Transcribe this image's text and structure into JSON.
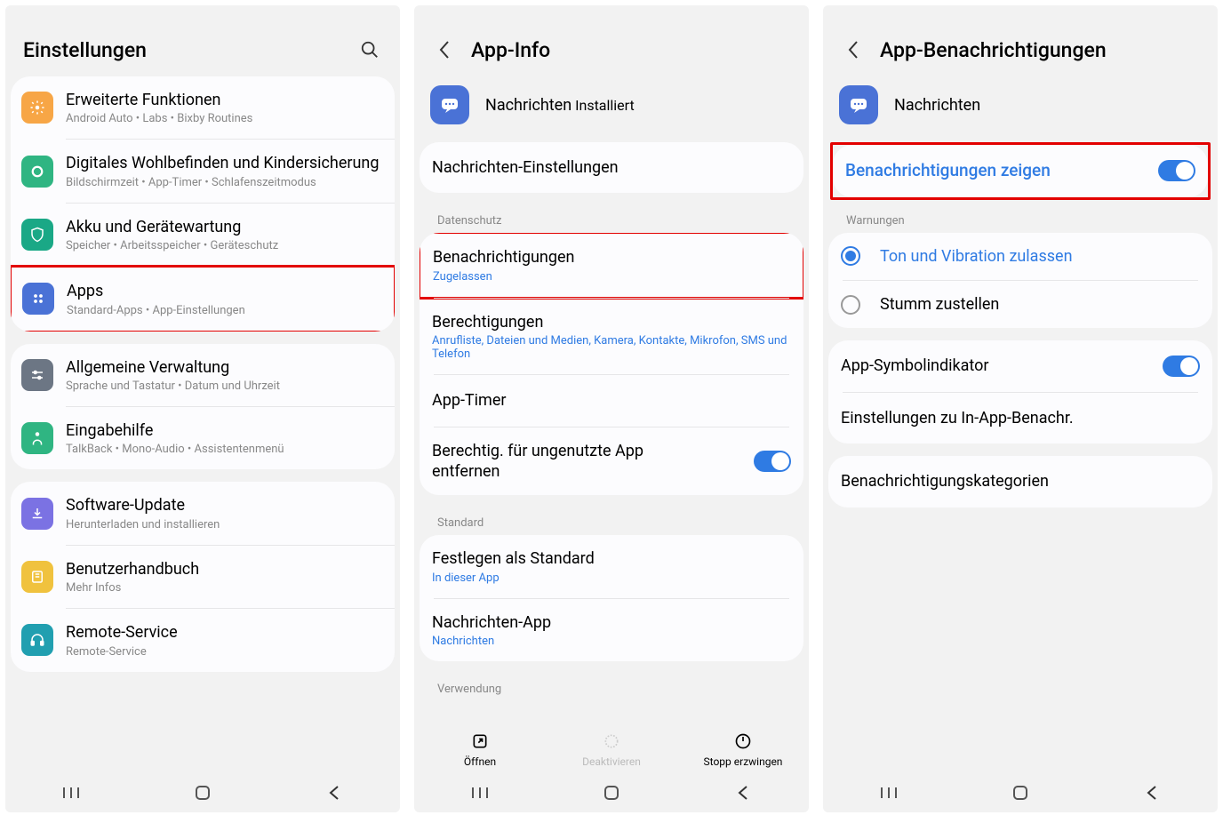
{
  "screen1": {
    "title": "Einstellungen",
    "groups": [
      {
        "items": [
          {
            "label": "Erweiterte Funktionen",
            "sub": "Android Auto  •  Labs  •  Bixby Routines",
            "color": "#f7a646",
            "highlight": false,
            "icon": "gear"
          },
          {
            "label": "Digitales Wohlbefinden und Kindersicherung",
            "sub": "Bildschirmzeit  •  App-Timer  •  Schlafenszeitmodus",
            "color": "#2fb582",
            "highlight": false,
            "icon": "ring"
          },
          {
            "label": "Akku und Gerätewartung",
            "sub": "Speicher  •  Arbeitsspeicher  •  Geräteschutz",
            "color": "#1aa886",
            "highlight": false,
            "icon": "shield"
          },
          {
            "label": "Apps",
            "sub": "Standard-Apps  •  App-Einstellungen",
            "color": "#4a72d6",
            "highlight": true,
            "icon": "grid"
          }
        ]
      },
      {
        "items": [
          {
            "label": "Allgemeine Verwaltung",
            "sub": "Sprache und Tastatur  •  Datum und Uhrzeit",
            "color": "#6c7684",
            "highlight": false,
            "icon": "sliders"
          },
          {
            "label": "Eingabehilfe",
            "sub": "TalkBack  •  Mono-Audio  •  Assistentenmenü",
            "color": "#2fb582",
            "highlight": false,
            "icon": "person"
          }
        ]
      },
      {
        "items": [
          {
            "label": "Software-Update",
            "sub": "Herunterladen und installieren",
            "color": "#7b72e3",
            "highlight": false,
            "icon": "download"
          },
          {
            "label": "Benutzerhandbuch",
            "sub": "Mehr Infos",
            "color": "#f0c23e",
            "highlight": false,
            "icon": "book"
          },
          {
            "label": "Remote-Service",
            "sub": "Remote-Service",
            "color": "#219fb0",
            "highlight": false,
            "icon": "headset"
          }
        ]
      }
    ]
  },
  "screen2": {
    "title": "App-Info",
    "app": {
      "name": "Nachrichten",
      "status": "Installiert"
    },
    "section_settings": "Nachrichten-Einstellungen",
    "section_priv": "Datenschutz",
    "notif": {
      "label": "Benachrichtigungen",
      "sub": "Zugelassen"
    },
    "perms": {
      "label": "Berechtigungen",
      "sub": "Anrufliste, Dateien und Medien, Kamera, Kontakte, Mikrofon, SMS und Telefon"
    },
    "timer": "App-Timer",
    "remove_unused": "Berechtig. für ungenutzte App entfernen",
    "section_std": "Standard",
    "set_default": {
      "label": "Festlegen als Standard",
      "sub": "In dieser App"
    },
    "msg_app": {
      "label": "Nachrichten-App",
      "sub": "Nachrichten"
    },
    "section_usage": "Verwendung",
    "actions": {
      "open": "Öffnen",
      "deactivate": "Deaktivieren",
      "stop": "Stopp erzwingen"
    }
  },
  "screen3": {
    "title": "App-Benachrichtigungen",
    "app_name": "Nachrichten",
    "show_notif": "Benachrichtigungen zeigen",
    "section_alerts": "Warnungen",
    "allow_sound": "Ton und Vibration zulassen",
    "silent": "Stumm zustellen",
    "badge": "App-Symbolindikator",
    "inapp": "Einstellungen zu In-App-Benachr.",
    "categories": "Benachrichtigungskategorien"
  }
}
